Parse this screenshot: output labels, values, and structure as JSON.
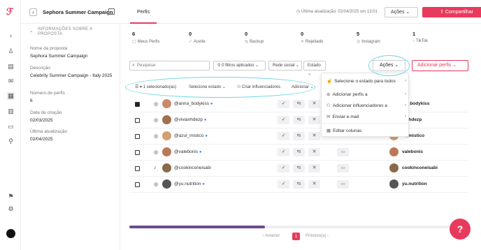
{
  "header": {
    "title": "Sephora Summer Campaign",
    "tab": "Perfis",
    "last_update": "Última atualização: 02/04/2025 um 13:01",
    "actions_label": "Ações",
    "share_label": "Compartilhar"
  },
  "info": {
    "section_title": "INFORMAÇÕES SOBRE A PROPOSTA",
    "fields": [
      {
        "label": "Nome da proposta",
        "value": "Sephora Summer Campaign"
      },
      {
        "label": "Descrição",
        "value": "Celebrity Summer Campaign - Italy 2025"
      },
      {
        "label": "Número de perfis",
        "value": "6"
      },
      {
        "label": "Data de criação",
        "value": "02/03/2025"
      },
      {
        "label": "Última atualização",
        "value": "02/04/2025"
      }
    ]
  },
  "stats": [
    {
      "num": "6",
      "label": "Meus Perfis",
      "icon": "profiles-icon"
    },
    {
      "num": "0",
      "label": "Aceite",
      "icon": "check-icon"
    },
    {
      "num": "0",
      "label": "Backup",
      "icon": "backup-icon"
    },
    {
      "num": "0",
      "label": "Rejeitado",
      "icon": "x-icon"
    },
    {
      "num": "5",
      "label": "Instagram",
      "icon": "instagram-icon"
    },
    {
      "num": "1",
      "label": "TikTok",
      "icon": "tiktok-icon"
    }
  ],
  "filters": {
    "search_placeholder": "Pesquisar",
    "applied": "0 filtros aplicados",
    "social": "Rede social",
    "state": "Estado",
    "actions": "Ações",
    "add_profiles": "Adicionar perfis"
  },
  "selection_bar": {
    "selected": "1 selecionado(as)",
    "select_state": "Selecione estado",
    "create_influencers": "Criar influenciadores",
    "add": "Adicionar"
  },
  "rows": [
    {
      "handle": "@anna_bodykiss",
      "platform": "instagram",
      "checked": true,
      "handle2": "ne_bodykiss",
      "avatar_color": "#c98a6a"
    },
    {
      "handle": "@vivianhdezp",
      "platform": "instagram",
      "checked": false,
      "handle2": "ianhdezp",
      "avatar_color": "#a0714f"
    },
    {
      "handle": "@azul_mistico",
      "platform": "instagram",
      "checked": false,
      "handle2": "ul_mistico",
      "avatar_color": "#d0a070"
    },
    {
      "handle": "@valebonis",
      "platform": "instagram",
      "checked": false,
      "handle2": "valebonis",
      "avatar_color": "#b97a5a"
    },
    {
      "handle": "@cookinconeisabi",
      "platform": "tiktok",
      "checked": false,
      "handle2": "cookinconeisabi",
      "avatar_color": "#8a6a4a"
    },
    {
      "handle": "@yu.nutrition",
      "platform": "instagram",
      "checked": false,
      "handle2": "yu.nutrition",
      "avatar_color": "#555555"
    }
  ],
  "menu": {
    "items": [
      {
        "label": "Selecione o estado para todos",
        "icon": "hand-icon",
        "submenu": true
      },
      {
        "label": "Adicionar perfis a",
        "icon": "plus-icon",
        "submenu": true
      },
      {
        "label": "Adicionar influenciadores a",
        "icon": "users-icon",
        "submenu": true
      },
      {
        "label": "Enviar e-mail",
        "icon": "mail-icon",
        "submenu": true
      },
      {
        "label": "Editar colunas",
        "icon": "columns-icon",
        "submenu": false
      }
    ]
  },
  "pagination": {
    "prev": "Anterior",
    "current": "1",
    "next": "Próximo(a)"
  },
  "colors": {
    "brand": "#e83a5c",
    "highlight": "#6fd6e6",
    "scroll_thumb": "#6e4b8e"
  }
}
